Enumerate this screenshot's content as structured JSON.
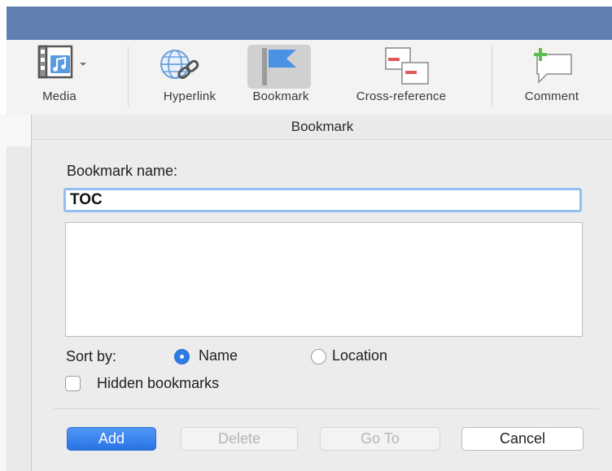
{
  "ribbon": {
    "items": [
      {
        "label": "Media",
        "icon": "media-icon"
      },
      {
        "label": "Hyperlink",
        "icon": "hyperlink-icon"
      },
      {
        "label": "Bookmark",
        "icon": "bookmark-flag-icon"
      },
      {
        "label": "Cross-reference",
        "icon": "cross-reference-icon"
      },
      {
        "label": "Comment",
        "icon": "comment-icon"
      }
    ]
  },
  "dialog": {
    "title": "Bookmark",
    "name_label": "Bookmark name:",
    "name_value": "TOC",
    "sort_label": "Sort by:",
    "sort_options": [
      "Name",
      "Location"
    ],
    "sort_selected": "Name",
    "hidden_label": "Hidden bookmarks",
    "hidden_checked": false,
    "buttons": {
      "add": "Add",
      "delete": "Delete",
      "goto": "Go To",
      "cancel": "Cancel"
    }
  },
  "colors": {
    "titlebar": "#6180b1",
    "accent": "#2f7be5",
    "focus_ring": "#94bff3"
  }
}
